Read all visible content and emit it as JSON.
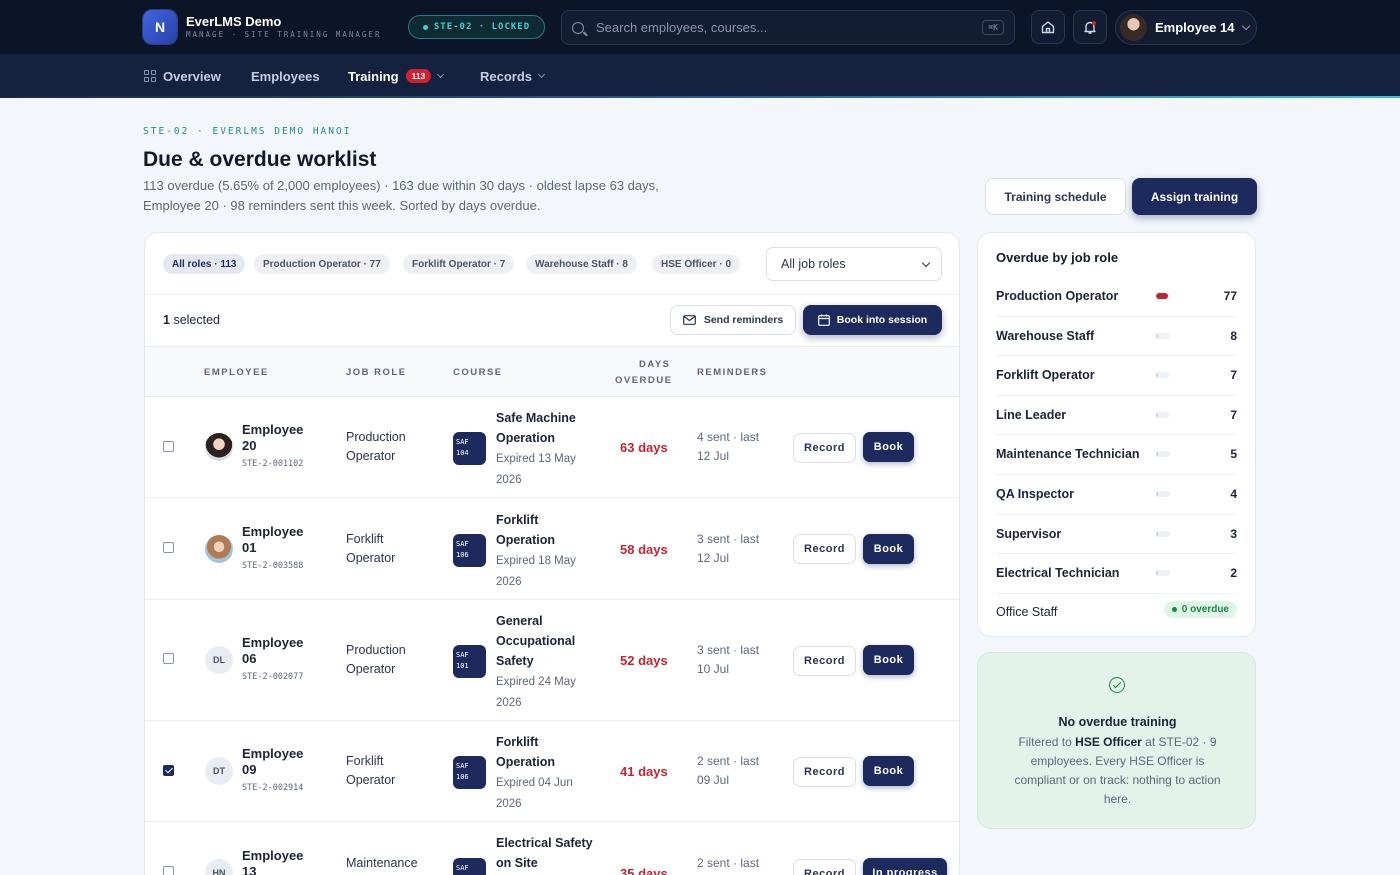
{
  "app": {
    "logo_letter": "N",
    "name": "EverLMS Demo",
    "subtitle": "MANAGE · SITE TRAINING MANAGER",
    "site_pill": "STE-02 · LOCKED"
  },
  "search": {
    "placeholder": "Search employees, courses...",
    "shortcut": "⌘K"
  },
  "user": {
    "name": "Employee 14"
  },
  "nav": {
    "overview": "Overview",
    "employees": "Employees",
    "training": "Training",
    "training_badge": "113",
    "records": "Records"
  },
  "header": {
    "eyebrow": "STE-02 · EVERLMS DEMO HANOI",
    "title": "Due & overdue worklist",
    "subtitle": "113 overdue (5.65% of 2,000 employees) · 163 due within 30 days · oldest lapse 63 days, Employee 20 · 98 reminders sent this week. Sorted by days overdue.",
    "schedule_button": "Training schedule",
    "assign_button": "Assign training"
  },
  "filters": {
    "chips": [
      "All roles · 113",
      "Production Operator · 77",
      "Forklift Operator · 7",
      "Warehouse Staff · 8",
      "HSE Officer · 0"
    ],
    "select_value": "All job roles"
  },
  "selection": {
    "count": "1",
    "label": "selected",
    "send_reminders": "Send reminders",
    "book_session": "Book into session"
  },
  "table": {
    "headers": {
      "employee": "EMPLOYEE",
      "job_role": "JOB ROLE",
      "course": "COURSE",
      "days_overdue_1": "DAYS",
      "days_overdue_2": "OVERDUE",
      "reminders": "REMINDERS"
    },
    "rows": [
      {
        "name_1": "Employee",
        "name_2": "20",
        "initials": "",
        "id": "STE-2-001102",
        "role_1": "Production",
        "role_2": "Operator",
        "course_code_1": "SAF",
        "course_code_2": "104",
        "course_name": "Safe Machine Operation",
        "expired": "Expired 13 May 2026",
        "days": "63 days",
        "rem_1": "4 sent · last",
        "rem_2": "12 Jul",
        "record": "Record",
        "action": "Book",
        "checked": false
      },
      {
        "name_1": "Employee",
        "name_2": "01",
        "initials": "",
        "id": "STE-2-003588",
        "role_1": "Forklift",
        "role_2": "Operator",
        "course_code_1": "SAF",
        "course_code_2": "106",
        "course_name": "Forklift Operation",
        "expired": "Expired 18 May 2026",
        "days": "58 days",
        "rem_1": "3 sent · last",
        "rem_2": "12 Jul",
        "record": "Record",
        "action": "Book",
        "checked": false
      },
      {
        "name_1": "Employee",
        "name_2": "06",
        "initials": "DL",
        "id": "STE-2-002077",
        "role_1": "Production",
        "role_2": "Operator",
        "course_code_1": "SAF",
        "course_code_2": "101",
        "course_name": "General Occupational Safety",
        "expired": "Expired 24 May 2026",
        "days": "52 days",
        "rem_1": "3 sent · last",
        "rem_2": "10 Jul",
        "record": "Record",
        "action": "Book",
        "checked": false
      },
      {
        "name_1": "Employee",
        "name_2": "09",
        "initials": "DT",
        "id": "STE-2-002914",
        "role_1": "Forklift",
        "role_2": "Operator",
        "course_code_1": "SAF",
        "course_code_2": "106",
        "course_name": "Forklift Operation",
        "expired": "Expired 04 Jun 2026",
        "days": "41 days",
        "rem_1": "2 sent · last",
        "rem_2": "09 Jul",
        "record": "Record",
        "action": "Book",
        "checked": true
      },
      {
        "name_1": "Employee",
        "name_2": "13",
        "initials": "HN",
        "id": "",
        "role_1": "Maintenance",
        "role_2": "",
        "course_code_1": "SAF",
        "course_code_2": "",
        "course_name": "Electrical Safety on Site",
        "expired": "",
        "days": "35 days",
        "rem_1": "2 sent · last",
        "rem_2": "",
        "record": "Record",
        "action": "In progress",
        "checked": false
      }
    ]
  },
  "side": {
    "title": "Overdue by job role",
    "roles": [
      {
        "name": "Production Operator",
        "count": "77",
        "fraction": 0.85
      },
      {
        "name": "Warehouse Staff",
        "count": "8",
        "fraction": 0.09
      },
      {
        "name": "Forklift Operator",
        "count": "7",
        "fraction": 0.08
      },
      {
        "name": "Line Leader",
        "count": "7",
        "fraction": 0.08
      },
      {
        "name": "Maintenance Technician",
        "count": "5",
        "fraction": 0.06
      },
      {
        "name": "QA Inspector",
        "count": "4",
        "fraction": 0.05
      },
      {
        "name": "Supervisor",
        "count": "3",
        "fraction": 0.04
      },
      {
        "name": "Electrical Technician",
        "count": "2",
        "fraction": 0.03
      }
    ],
    "office_staff": {
      "name": "Office Staff",
      "badge": "0 overdue"
    }
  },
  "empty_state": {
    "title": "No overdue training",
    "body_prefix": "Filtered to ",
    "body_bold": "HSE Officer",
    "body_suffix": " at STE-02 · 9 employees. Every HSE Officer is compliant or on track: nothing to action here."
  },
  "colors": {
    "brand": "#1c2a5e",
    "overdue": "#c62332",
    "accent": "#3fc0d8",
    "ok": "#168a45"
  }
}
